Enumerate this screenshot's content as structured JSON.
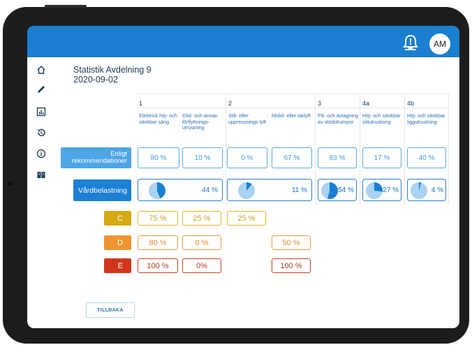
{
  "header": {
    "avatar_initials": "AM"
  },
  "page": {
    "title": "Statistik Avdelning 9",
    "date": "2020-09-02"
  },
  "sidebar": {
    "icons": [
      "home-icon",
      "edit-icon",
      "chart-icon",
      "history-icon",
      "info-icon",
      "book-icon"
    ]
  },
  "columns": [
    {
      "num": "1",
      "desc": "Elektrisk höj- och sänkbar säng"
    },
    {
      "num": "",
      "desc": "Glid- och annan förflyttnings-utrustning"
    },
    {
      "num": "2",
      "desc": "Stå- eller uppressnings lyft"
    },
    {
      "num": "",
      "desc": "Mobil- eller taklyft"
    },
    {
      "num": "3",
      "desc": "På- och avtagning av stödstrumpor"
    },
    {
      "num": "4a",
      "desc": "Höj- och sänkbar sittutrustning"
    },
    {
      "num": "4b",
      "desc": "Höj- och sänkbar liggutrustning"
    }
  ],
  "rows": {
    "enligt": {
      "label": "Enligt rekommendationer",
      "values": [
        "80 %",
        "10 %",
        "0 %",
        "67 %",
        "83 %",
        "17 %",
        "40 %"
      ]
    },
    "vardbelastning": {
      "label": "Vårdbelastning",
      "items": [
        {
          "value": "44 %",
          "fraction": 0.44
        },
        {
          "value": "11 %",
          "fraction": 0.11
        },
        {
          "value": "54 %",
          "fraction": 0.54
        },
        {
          "value": "27 %",
          "fraction": 0.27
        },
        {
          "value": "4 %",
          "fraction": 0.04
        }
      ]
    },
    "c": {
      "label": "C",
      "values": [
        "75 %",
        "25 %",
        "25 %"
      ]
    },
    "d": {
      "label": "D",
      "values": [
        "80 %",
        "0 %",
        "50 %"
      ]
    },
    "e": {
      "label": "E",
      "values": [
        "100 %",
        "0%",
        "100 %"
      ]
    }
  },
  "colors": {
    "accent": "#1a7fd1",
    "enligt_label": "#4ea5e6",
    "vard_label": "#1b7fd4",
    "c": "#d5aa12",
    "d": "#ee952f",
    "e": "#d0361a",
    "pie_fill": "#1a7fd1",
    "pie_bg": "#a9d2f3"
  },
  "buttons": {
    "back": "TILLBAKA"
  }
}
